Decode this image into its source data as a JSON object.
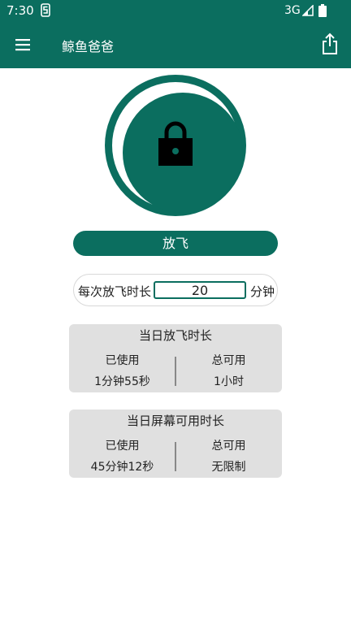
{
  "status_bar": {
    "time": "7:30",
    "network": "3G"
  },
  "app_bar": {
    "title": "鲸鱼爸爸"
  },
  "takeoff_button": {
    "label": "放飞"
  },
  "duration": {
    "label": "每次放飞时长",
    "value": "20",
    "unit": "分钟"
  },
  "daily_flight": {
    "title": "当日放飞时长",
    "used_label": "已使用",
    "used_value": "1分钟55秒",
    "total_label": "总可用",
    "total_value": "1小时"
  },
  "daily_screen": {
    "title": "当日屏幕可用时长",
    "used_label": "已使用",
    "used_value": "45分钟12秒",
    "total_label": "总可用",
    "total_value": "无限制"
  },
  "colors": {
    "primary": "#0b6e5f",
    "card_bg": "#e0e0e0"
  }
}
